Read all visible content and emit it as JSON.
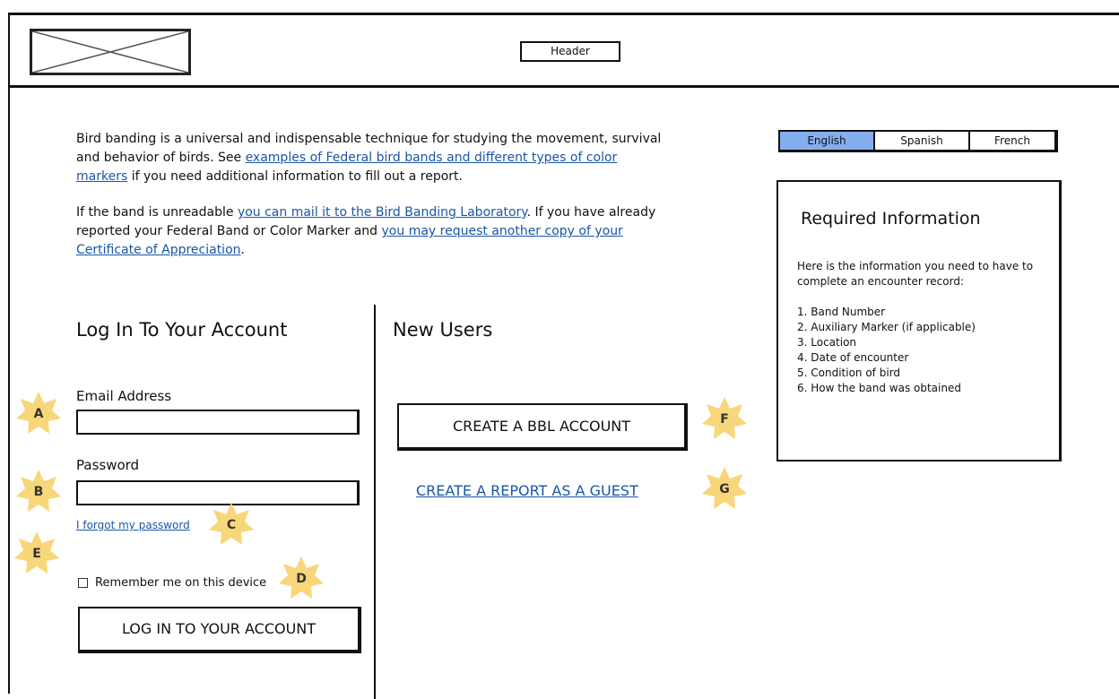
{
  "header": {
    "label": "Header"
  },
  "intro": {
    "p1_a": "Bird banding is a universal and indispensable technique for studying the movement, survival and behavior of birds. See ",
    "p1_link": "examples of Federal bird bands and different types of color markers",
    "p1_b": " if you need additional information to fill out a report.",
    "p2_a": "If the band is unreadable ",
    "p2_link1": "you can mail it to the Bird Banding Laboratory",
    "p2_b": ". If you have already reported your Federal Band or Color Marker and ",
    "p2_link2": "you may request another copy of your Certificate of Appreciation",
    "p2_c": "."
  },
  "languages": {
    "items": [
      "English",
      "Spanish",
      "French"
    ],
    "selected": "English",
    "active_color": "#85aef0"
  },
  "required_info": {
    "title": "Required Information",
    "description": "Here is the information you need to have to complete an encounter record:",
    "items": [
      "1. Band Number",
      "2. Auxiliary Marker (if applicable)",
      "3. Location",
      "4. Date of encounter",
      "5. Condition of bird",
      "6. How the band was obtained"
    ]
  },
  "login": {
    "heading": "Log In To Your Account",
    "email_label": "Email Address",
    "email_value": "",
    "password_label": "Password",
    "password_value": "",
    "forgot_link": "I forgot my password",
    "remember_label": "Remember me on this device",
    "button": "LOG IN TO YOUR ACCOUNT"
  },
  "new_users": {
    "heading": "New Users",
    "create_button": "CREATE A BBL ACCOUNT",
    "guest_link": "CREATE A REPORT AS A GUEST"
  },
  "callouts": [
    "A",
    "B",
    "C",
    "D",
    "E",
    "F",
    "G"
  ],
  "colors": {
    "link": "#1a56a8",
    "callout": "#f8d67a"
  }
}
